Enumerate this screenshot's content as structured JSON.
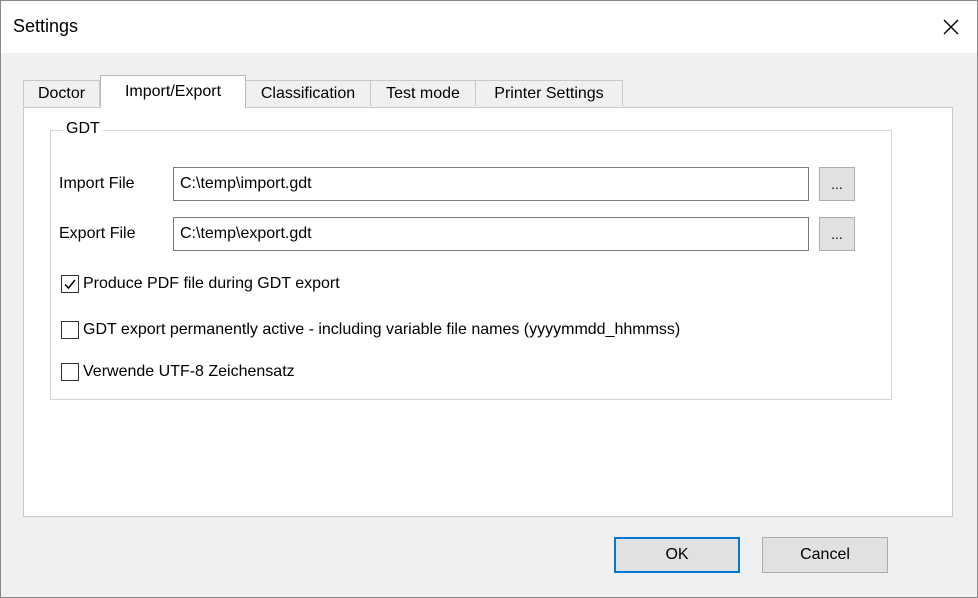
{
  "window": {
    "title": "Settings",
    "close_icon": "close-icon"
  },
  "tabs": [
    {
      "label": "Doctor",
      "active": false
    },
    {
      "label": "Import/Export",
      "active": true
    },
    {
      "label": "Classification",
      "active": false
    },
    {
      "label": "Test mode",
      "active": false
    },
    {
      "label": "Printer Settings",
      "active": false
    }
  ],
  "gdt": {
    "group_title": "GDT",
    "import_label": "Import File",
    "import_value": "C:\\temp\\import.gdt",
    "export_label": "Export File",
    "export_value": "C:\\temp\\export.gdt",
    "browse_label": "...",
    "options": [
      {
        "label": "Produce PDF file during GDT export",
        "checked": true
      },
      {
        "label": "GDT export permanently active - including variable file names (yyyymmdd_hhmmss)",
        "checked": false
      },
      {
        "label": "Verwende UTF-8 Zeichensatz",
        "checked": false
      }
    ]
  },
  "buttons": {
    "ok_label": "OK",
    "cancel_label": "Cancel"
  },
  "colors": {
    "accent": "#0078d7",
    "window_bg": "#f0f0f0",
    "panel_bg": "#ffffff"
  }
}
